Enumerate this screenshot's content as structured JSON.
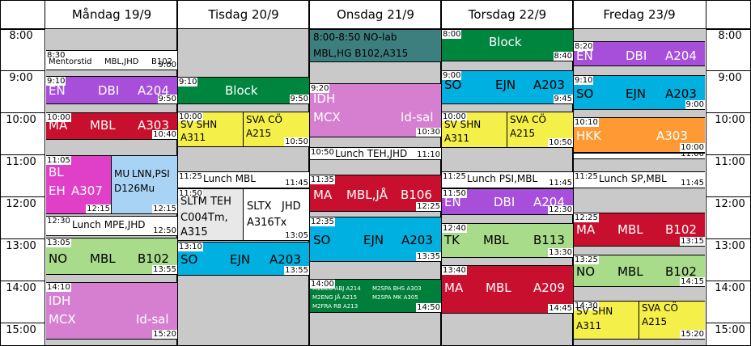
{
  "days": [
    {
      "label": "Måndag 19/9"
    },
    {
      "label": "Tisdag 20/9"
    },
    {
      "label": "Onsdag 21/9"
    },
    {
      "label": "Torsdag 22/9"
    },
    {
      "label": "Fredag 23/9"
    }
  ],
  "times": [
    "8:00",
    "9:00",
    "10:00",
    "11:00",
    "12:00",
    "13:00",
    "14:00",
    "15:00"
  ],
  "colors": {
    "bg": "#c9c9c9",
    "white": "#ffffff",
    "purple": "#a74fdb",
    "red": "#c8102e",
    "magenta": "#e040c8",
    "lightblue": "#a9d3f5",
    "lightgreen": "#a8db8a",
    "pink": "#d67fd0",
    "green": "#00853f",
    "yellow": "#f5ef4a",
    "lightgray": "#e8e8e8",
    "cyan": "#00b0e0",
    "teal": "#3d7f7f",
    "darkgreen": "#007f3a",
    "orange": "#ff9933"
  },
  "events": [
    {
      "day": 0,
      "start": "8:30",
      "end": "9:00",
      "color": "white",
      "texts": [
        {
          "text": "Mentorstid",
          "size": 10
        },
        {
          "text": "MBL,JHD",
          "size": 10
        },
        {
          "text": "B102",
          "size": 10
        }
      ]
    },
    {
      "day": 0,
      "start": "9:10",
      "end": "9:50",
      "color": "purple",
      "texts": [
        {
          "text": "EN",
          "size": 15,
          "c": "#fff"
        },
        {
          "text": "DBI",
          "size": 15,
          "c": "#fff"
        },
        {
          "text": "A204",
          "size": 15,
          "c": "#fff"
        }
      ]
    },
    {
      "day": 0,
      "start": "10:00",
      "end": "10:40",
      "color": "red",
      "texts": [
        {
          "text": "MA",
          "size": 15,
          "c": "#fff"
        },
        {
          "text": "MBL",
          "size": 15,
          "c": "#fff"
        },
        {
          "text": "A303",
          "size": 15,
          "c": "#fff"
        }
      ]
    },
    {
      "day": 0,
      "start": "11:05",
      "end": "12:15",
      "color": "magenta",
      "texts": [
        {
          "text": "BL",
          "size": 15,
          "c": "#fff"
        },
        {
          "text": "EH",
          "size": 15,
          "c": "#fff"
        },
        {
          "text": "A307",
          "size": 15,
          "c": "#fff"
        }
      ]
    },
    {
      "day": 0,
      "end": "12:15",
      "color": "lightblue",
      "texts": [
        {
          "text": "MU",
          "size": 12
        },
        {
          "text": "LNN,PSI",
          "size": 12
        },
        {
          "text": "D126Mu",
          "size": 12
        }
      ]
    },
    {
      "day": 0,
      "start": "12:30",
      "end": "12:50",
      "color": "white",
      "texts": [
        {
          "text": "Lunch MPE,JHD",
          "size": 12
        }
      ]
    },
    {
      "day": 0,
      "start": "13:05",
      "end": "13:55",
      "color": "lightgreen",
      "texts": [
        {
          "text": "NO",
          "size": 15
        },
        {
          "text": "MBL",
          "size": 15
        },
        {
          "text": "B102",
          "size": 15
        }
      ]
    },
    {
      "day": 0,
      "start": "14:10",
      "end": "15:20",
      "color": "pink",
      "texts": [
        {
          "text": "IDH",
          "size": 15,
          "c": "#fff"
        },
        {
          "text": "MCX",
          "size": 15,
          "c": "#fff"
        },
        {
          "text": "Id-sal",
          "size": 15,
          "c": "#fff"
        }
      ]
    },
    {
      "day": 1,
      "start": "9:10",
      "end": "9:50",
      "color": "green",
      "texts": [
        {
          "text": "Block",
          "size": 15,
          "c": "#fff"
        }
      ]
    },
    {
      "day": 1,
      "start": "10:00",
      "color": "yellow",
      "texts": [
        {
          "text": "SV SHN",
          "size": 12
        },
        {
          "text": "A311",
          "size": 12
        }
      ]
    },
    {
      "day": 1,
      "end": "10:50",
      "color": "yellow",
      "texts": [
        {
          "text": "SVA CÖ",
          "size": 12
        },
        {
          "text": "A215",
          "size": 12
        }
      ]
    },
    {
      "day": 1,
      "start": "11:25",
      "end": "11:45",
      "color": "white",
      "texts": [
        {
          "text": "Lunch MBL",
          "size": 12
        }
      ]
    },
    {
      "day": 1,
      "start": "11:50",
      "color": "lightgray",
      "texts": [
        {
          "text": "SLTM TEH",
          "size": 13
        },
        {
          "text": "C004Tm,",
          "size": 13
        },
        {
          "text": "A315",
          "size": 13
        }
      ]
    },
    {
      "day": 1,
      "end": "13:05",
      "color": "white",
      "texts": [
        {
          "text": "SLTX",
          "size": 13
        },
        {
          "text": "JHD",
          "size": 13
        },
        {
          "text": "A316Tx",
          "size": 13
        }
      ]
    },
    {
      "day": 1,
      "start": "13:10",
      "end": "13:55",
      "color": "cyan",
      "texts": [
        {
          "text": "SO",
          "size": 15
        },
        {
          "text": "EJN",
          "size": 15
        },
        {
          "text": "A203",
          "size": 15
        }
      ]
    },
    {
      "day": 2,
      "color": "teal",
      "texts": [
        {
          "text": "8:00-8:50 NO-lab",
          "size": 12
        },
        {
          "text": "MBL,HG B102,A315",
          "size": 12
        }
      ]
    },
    {
      "day": 2,
      "start": "9:20",
      "end": "10:30",
      "color": "pink",
      "texts": [
        {
          "text": "IDH",
          "size": 15,
          "c": "#fff"
        },
        {
          "text": "MCX",
          "size": 15,
          "c": "#fff"
        },
        {
          "text": "Id-sal",
          "size": 15,
          "c": "#fff"
        }
      ]
    },
    {
      "day": 2,
      "start": "10:50",
      "end": "11:10",
      "color": "white",
      "texts": [
        {
          "text": "Lunch TEH,JHD",
          "size": 12
        }
      ]
    },
    {
      "day": 2,
      "start": "11:35",
      "end": "12:25",
      "color": "red",
      "texts": [
        {
          "text": "MA",
          "size": 15,
          "c": "#fff"
        },
        {
          "text": "MBL,JÅ",
          "size": 15,
          "c": "#fff"
        },
        {
          "text": "B106",
          "size": 15,
          "c": "#fff"
        }
      ]
    },
    {
      "day": 2,
      "start": "12:35",
      "end": "13:35",
      "color": "cyan",
      "texts": [
        {
          "text": "SO",
          "size": 15
        },
        {
          "text": "EJN",
          "size": 15
        },
        {
          "text": "A203",
          "size": 15
        }
      ]
    },
    {
      "day": 2,
      "start": "14:00",
      "end": "14:50",
      "color": "darkgreen",
      "texts": [
        {
          "text": "M2DEU ABJ A214",
          "size": 7,
          "c": "#fff"
        },
        {
          "text": "M2ENG JÅ A215",
          "size": 7,
          "c": "#fff"
        },
        {
          "text": "M2FRA RB A213",
          "size": 7,
          "c": "#fff"
        },
        {
          "text": "M2SPA BHS A303",
          "size": 7,
          "c": "#fff"
        },
        {
          "text": "M2SPA MK A305",
          "size": 7,
          "c": "#fff"
        }
      ]
    },
    {
      "day": 3,
      "start": "8:00",
      "end": "8:40",
      "color": "green",
      "texts": [
        {
          "text": "Block",
          "size": 15,
          "c": "#fff"
        }
      ]
    },
    {
      "day": 3,
      "start": "9:00",
      "end": "9:45",
      "color": "cyan",
      "texts": [
        {
          "text": "SO",
          "size": 15
        },
        {
          "text": "EJN",
          "size": 15
        },
        {
          "text": "A203",
          "size": 15
        }
      ]
    },
    {
      "day": 3,
      "start": "10:00",
      "color": "yellow",
      "texts": [
        {
          "text": "SV SHN",
          "size": 12
        },
        {
          "text": "A311",
          "size": 12
        }
      ]
    },
    {
      "day": 3,
      "end": "10:50",
      "color": "yellow",
      "texts": [
        {
          "text": "SVA CÖ",
          "size": 12
        },
        {
          "text": "A215",
          "size": 12
        }
      ]
    },
    {
      "day": 3,
      "start": "11:25",
      "end": "11:45",
      "color": "white",
      "texts": [
        {
          "text": "Lunch PSI,MBL",
          "size": 12
        }
      ]
    },
    {
      "day": 3,
      "start": "11:50",
      "end": "12:30",
      "color": "purple",
      "texts": [
        {
          "text": "EN",
          "size": 15,
          "c": "#fff"
        },
        {
          "text": "DBI",
          "size": 15,
          "c": "#fff"
        },
        {
          "text": "A204",
          "size": 15,
          "c": "#fff"
        }
      ]
    },
    {
      "day": 3,
      "start": "12:40",
      "end": "13:30",
      "color": "lightgreen",
      "texts": [
        {
          "text": "TK",
          "size": 15
        },
        {
          "text": "MBL",
          "size": 15
        },
        {
          "text": "B113",
          "size": 15
        }
      ]
    },
    {
      "day": 3,
      "start": "13:40",
      "end": "14:45",
      "color": "red",
      "texts": [
        {
          "text": "MA",
          "size": 15,
          "c": "#fff"
        },
        {
          "text": "MBL",
          "size": 15,
          "c": "#fff"
        },
        {
          "text": "A209",
          "size": 15,
          "c": "#fff"
        }
      ]
    },
    {
      "day": 4,
      "start": "8:20",
      "color": "purple",
      "texts": [
        {
          "text": "EN",
          "size": 15,
          "c": "#fff"
        },
        {
          "text": "DBI",
          "size": 15,
          "c": "#fff"
        },
        {
          "text": "A204",
          "size": 15,
          "c": "#fff"
        }
      ]
    },
    {
      "day": 4,
      "start": "9:10",
      "end": "9:00",
      "color": "cyan",
      "texts": [
        {
          "text": "SO",
          "size": 15
        },
        {
          "text": "EJN",
          "size": 15
        },
        {
          "text": "A203",
          "size": 15
        }
      ]
    },
    {
      "day": 4,
      "start": "10:10",
      "end": "10:00",
      "color": "orange",
      "texts": [
        {
          "text": "HKK",
          "size": 15,
          "c": "#fff"
        },
        {
          "text": "A303",
          "size": 15,
          "c": "#fff"
        }
      ]
    },
    {
      "day": 4,
      "start": "",
      "end": "11:00",
      "color": "white",
      "texts": []
    },
    {
      "day": 4,
      "start": "11:25",
      "end": "11:45",
      "color": "white",
      "texts": [
        {
          "text": "Lunch SP,MBL",
          "size": 12
        }
      ]
    },
    {
      "day": 4,
      "start": "12:25",
      "end": "13:15",
      "color": "red",
      "texts": [
        {
          "text": "MA",
          "size": 15,
          "c": "#fff"
        },
        {
          "text": "MBL",
          "size": 15,
          "c": "#fff"
        },
        {
          "text": "B102",
          "size": 15,
          "c": "#fff"
        }
      ]
    },
    {
      "day": 4,
      "start": "13:25",
      "end": "14:15",
      "color": "lightgreen",
      "texts": [
        {
          "text": "NO",
          "size": 15
        },
        {
          "text": "MBL",
          "size": 15
        },
        {
          "text": "B102",
          "size": 15
        }
      ]
    },
    {
      "day": 4,
      "start": "14:30",
      "color": "yellow",
      "texts": [
        {
          "text": "SV SHN",
          "size": 12
        },
        {
          "text": "A311",
          "size": 12
        }
      ]
    },
    {
      "day": 4,
      "end": "15:20",
      "color": "yellow",
      "texts": [
        {
          "text": "SVA CÖ",
          "size": 12
        },
        {
          "text": "A215",
          "size": 12
        }
      ]
    }
  ]
}
